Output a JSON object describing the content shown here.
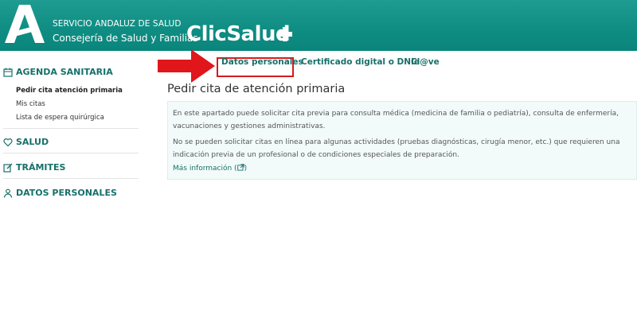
{
  "header": {
    "org_line1": "SERVICIO ANDALUZ DE SALUD",
    "org_line2": "Consejería de Salud y Familias",
    "brand": "ClicSalud",
    "colors": {
      "header": "#108e84",
      "accent": "#17706a",
      "highlight": "#d51b1b"
    },
    "logo": "junta-andalucia-logo",
    "brand_symbol": "plus-icon"
  },
  "sidebar": {
    "sections": [
      {
        "icon": "calendar-icon",
        "label": "AGENDA SANITARIA",
        "items": [
          {
            "label": "Pedir cita atención primaria",
            "active": true
          },
          {
            "label": "Mis citas",
            "active": false
          },
          {
            "label": "Lista de espera quirúrgica",
            "active": false
          }
        ]
      },
      {
        "icon": "heart-icon",
        "label": "SALUD"
      },
      {
        "icon": "edit-icon",
        "label": "TRÁMITES"
      },
      {
        "icon": "user-icon",
        "label": "DATOS PERSONALES"
      }
    ]
  },
  "tabs": {
    "items": [
      {
        "label": "Datos personales",
        "highlighted": true
      },
      {
        "label": "Certificado digital o DNIe"
      },
      {
        "label": "Cl@ve"
      }
    ]
  },
  "main": {
    "title": "Pedir cita de atención primaria",
    "paragraph1": "En este apartado puede solicitar cita previa para consulta médica (medicina de familia o pediatría), consulta de enfermería, vacunaciones y gestiones administrativas.",
    "paragraph2": "No se pueden solicitar citas en línea para algunas actividades (pruebas diagnósticas, cirugía menor, etc.) que requieren una indicación previa de un profesional o de condiciones especiales de preparación.",
    "more_info": "Más información (",
    "more_info_end": ")",
    "external_icon": "external-link-icon"
  }
}
